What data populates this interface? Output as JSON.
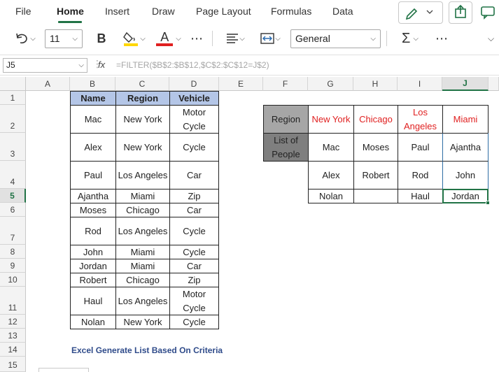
{
  "menu": {
    "tabs": [
      "File",
      "Home",
      "Insert",
      "Draw",
      "Page Layout",
      "Formulas",
      "Data"
    ]
  },
  "toolbar": {
    "font_size": "11",
    "bold_label": "B",
    "font_color_label": "A",
    "more_label": "⋯",
    "number_format": "General",
    "more_label2": "⋯"
  },
  "formula_bar": {
    "name_box": "J5",
    "fx_label": "fx",
    "formula": "=FILTER($B$2:$B$12,$C$2:$C$12=J$2)"
  },
  "columns": [
    "A",
    "B",
    "C",
    "D",
    "E",
    "F",
    "G",
    "H",
    "I",
    "J"
  ],
  "rows": [
    "1",
    "2",
    "3",
    "4",
    "5",
    "6",
    "7",
    "8",
    "9",
    "10",
    "11",
    "12",
    "13",
    "14",
    "15"
  ],
  "table": {
    "headers": [
      "Name",
      "Region",
      "Vehicle"
    ],
    "rows": [
      [
        "Mac",
        "New York",
        "Motor Cycle"
      ],
      [
        "Alex",
        "New York",
        "Cycle"
      ],
      [
        "Paul",
        "Los Angeles",
        "Car"
      ],
      [
        "Ajantha",
        "Miami",
        "Zip"
      ],
      [
        "Moses",
        "Chicago",
        "Car"
      ],
      [
        "Rod",
        "Los Angeles",
        "Cycle"
      ],
      [
        "John",
        "Miami",
        "Cycle"
      ],
      [
        "Jordan",
        "Miami",
        "Car"
      ],
      [
        "Robert",
        "Chicago",
        "Zip"
      ],
      [
        "Haul",
        "Los Angeles",
        "Motor Cycle"
      ],
      [
        "Nolan",
        "New York",
        "Cycle"
      ]
    ]
  },
  "result": {
    "region_label": "Region",
    "people_label": "List of People",
    "regions": [
      "New York",
      "Chicago",
      "Los Angeles",
      "Miami"
    ],
    "rows": [
      [
        "Mac",
        "Moses",
        "Paul",
        "Ajantha"
      ],
      [
        "Alex",
        "Robert",
        "Rod",
        "John"
      ],
      [
        "Nolan",
        "",
        "Haul",
        "Jordan"
      ]
    ]
  },
  "caption": "Excel Generate List Based On Criteria",
  "colors": {
    "accent": "#217346",
    "header_fill": "#b4c6e7",
    "region_text": "#e02020",
    "caption": "#2f4b8a"
  }
}
